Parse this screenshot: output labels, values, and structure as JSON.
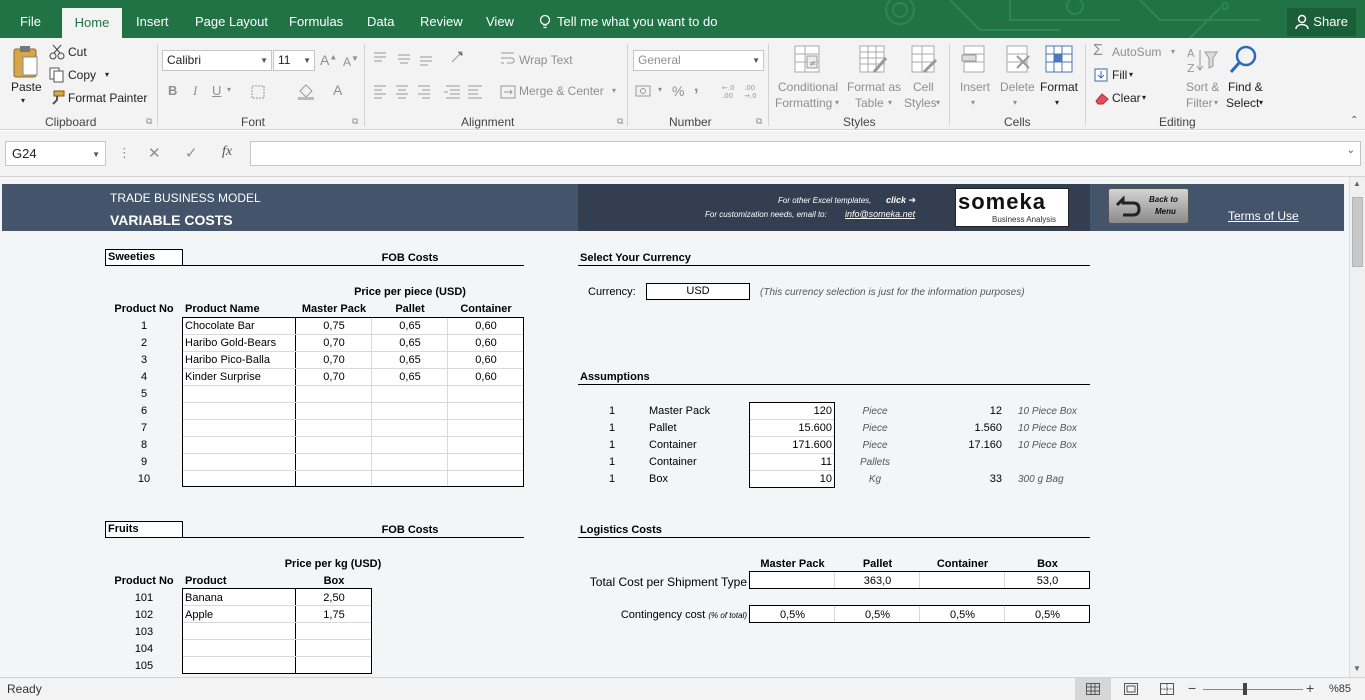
{
  "tabs": [
    "File",
    "Home",
    "Insert",
    "Page Layout",
    "Formulas",
    "Data",
    "Review",
    "View"
  ],
  "tell_me": "Tell me what you want to do",
  "share": "Share",
  "clipboard": {
    "paste": "Paste",
    "cut": "Cut",
    "copy": "Copy",
    "format_painter": "Format Painter",
    "group": "Clipboard"
  },
  "font": {
    "name": "Calibri",
    "size": "11",
    "bold": "B",
    "italic": "I",
    "underline": "U",
    "font_color": "A",
    "group": "Font"
  },
  "alignment": {
    "wrap": "Wrap Text",
    "merge": "Merge & Center",
    "group": "Alignment"
  },
  "number": {
    "format": "General",
    "percent": "%",
    "comma": ",",
    "group": "Number"
  },
  "styles": {
    "conditional": "Conditional",
    "conditional2": "Formatting",
    "format_as": "Format as",
    "format_as2": "Table",
    "cell": "Cell",
    "cell2": "Styles",
    "group": "Styles"
  },
  "cells": {
    "insert": "Insert",
    "delete": "Delete",
    "format": "Format",
    "group": "Cells"
  },
  "editing": {
    "autosum": "AutoSum",
    "fill": "Fill",
    "clear": "Clear",
    "sort": "Sort &",
    "sort2": "Filter",
    "find": "Find &",
    "find2": "Select",
    "group": "Editing"
  },
  "formula_bar": {
    "name_box": "G24",
    "fx": "fx",
    "value": ""
  },
  "sheet": {
    "model": "TRADE BUSINESS MODEL",
    "title": "VARIABLE COSTS",
    "templates_text": "For other Excel templates,",
    "click": "click",
    "custom_text": "For customization needs, email to:",
    "email": "info@someka.net",
    "logo": "someka",
    "logo_sub": "Business Analysis",
    "back_line1": "Back to",
    "back_line2": "Menu",
    "terms": "Terms of Use",
    "sweeties": {
      "label": "Sweeties",
      "fob": "FOB Costs",
      "price_header": "Price per piece (USD)",
      "columns": [
        "Product No",
        "Product Name",
        "Master Pack",
        "Pallet",
        "Container"
      ],
      "rows": [
        {
          "no": "1",
          "name": "Chocolate Bar",
          "mp": "0,75",
          "pallet": "0,65",
          "cont": "0,60"
        },
        {
          "no": "2",
          "name": "Haribo Gold-Bears",
          "mp": "0,70",
          "pallet": "0,65",
          "cont": "0,60"
        },
        {
          "no": "3",
          "name": "Haribo Pico-Balla",
          "mp": "0,70",
          "pallet": "0,65",
          "cont": "0,60"
        },
        {
          "no": "4",
          "name": "Kinder Surprise",
          "mp": "0,70",
          "pallet": "0,65",
          "cont": "0,60"
        },
        {
          "no": "5",
          "name": "",
          "mp": "",
          "pallet": "",
          "cont": ""
        },
        {
          "no": "6",
          "name": "",
          "mp": "",
          "pallet": "",
          "cont": ""
        },
        {
          "no": "7",
          "name": "",
          "mp": "",
          "pallet": "",
          "cont": ""
        },
        {
          "no": "8",
          "name": "",
          "mp": "",
          "pallet": "",
          "cont": ""
        },
        {
          "no": "9",
          "name": "",
          "mp": "",
          "pallet": "",
          "cont": ""
        },
        {
          "no": "10",
          "name": "",
          "mp": "",
          "pallet": "",
          "cont": ""
        }
      ]
    },
    "fruits": {
      "label": "Fruits",
      "fob": "FOB Costs",
      "price_header": "Price per kg (USD)",
      "columns": [
        "Product No",
        "Product",
        "Box"
      ],
      "rows": [
        {
          "no": "101",
          "name": "Banana",
          "box": "2,50"
        },
        {
          "no": "102",
          "name": "Apple",
          "box": "1,75"
        },
        {
          "no": "103",
          "name": "",
          "box": ""
        },
        {
          "no": "104",
          "name": "",
          "box": ""
        },
        {
          "no": "105",
          "name": "",
          "box": ""
        }
      ]
    },
    "currency": {
      "section": "Select Your Currency",
      "label": "Currency:",
      "value": "USD",
      "note": "(This currency selection is just for the information purposes)"
    },
    "assumptions": {
      "section": "Assumptions",
      "rows": [
        {
          "qty": "1",
          "name": "Master Pack",
          "value": "120",
          "unit": "Piece",
          "conv": "12",
          "conv_unit": "10 Piece Box"
        },
        {
          "qty": "1",
          "name": "Pallet",
          "value": "15.600",
          "unit": "Piece",
          "conv": "1.560",
          "conv_unit": "10 Piece Box"
        },
        {
          "qty": "1",
          "name": "Container",
          "value": "171.600",
          "unit": "Piece",
          "conv": "17.160",
          "conv_unit": "10 Piece Box"
        },
        {
          "qty": "1",
          "name": "Container",
          "value": "11",
          "unit": "Pallets",
          "conv": "",
          "conv_unit": ""
        },
        {
          "qty": "1",
          "name": "Box",
          "value": "10",
          "unit": "Kg",
          "conv": "33",
          "conv_unit": "300 g Bag"
        }
      ]
    },
    "logistics": {
      "section": "Logistics Costs",
      "columns": [
        "Master Pack",
        "Pallet",
        "Container",
        "Box"
      ],
      "total_label": "Total Cost per Shipment Type",
      "total": [
        "",
        "363,0",
        "",
        "53,0"
      ],
      "contingency_label": "Contingency cost",
      "contingency_note": "(% of total)",
      "contingency": [
        "0,5%",
        "0,5%",
        "0,5%",
        "0,5%"
      ]
    }
  },
  "status": {
    "ready": "Ready",
    "zoom": "%85"
  }
}
